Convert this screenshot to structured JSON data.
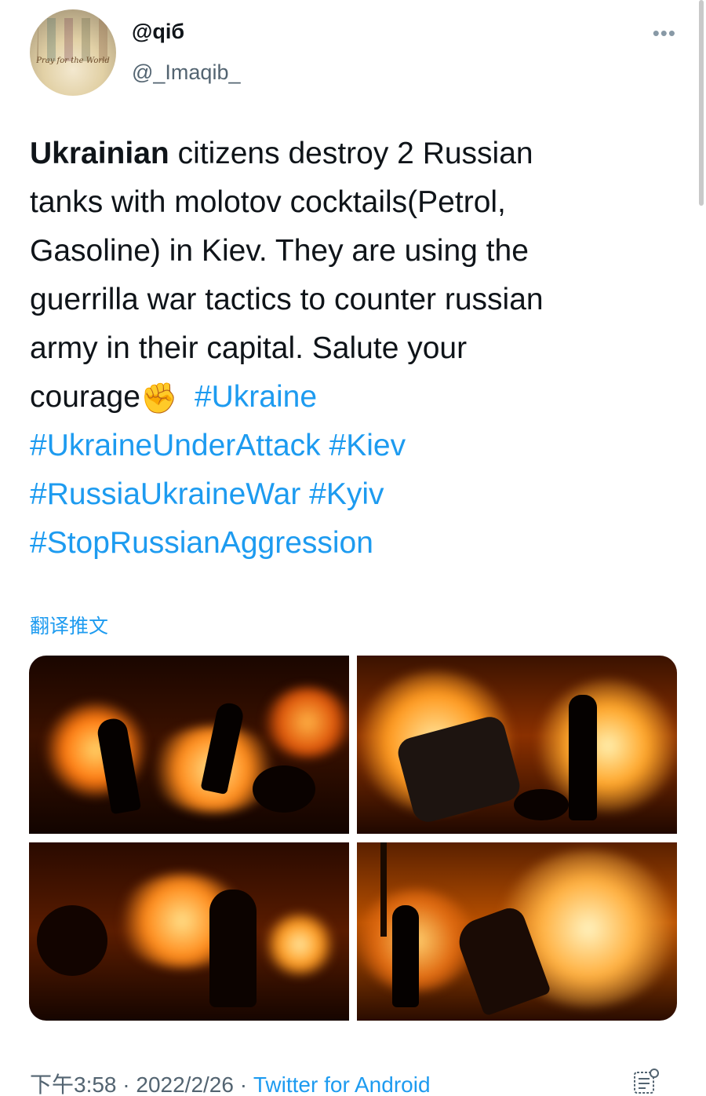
{
  "tweet": {
    "author": {
      "display_name": "@qiб",
      "handle": "@_Imaqib_",
      "avatar_text": "Pray for the World"
    },
    "more_icon": "more-horizontal-icon",
    "text_parts": {
      "bold_lead": "Ukrainian",
      "line_1_rest": " citizens destroy 2 Russian",
      "line_2": "tanks with molotov cocktails(Petrol,",
      "line_3": "Gasoline) in Kiev. They are using the",
      "line_4": "guerrilla war tactics to counter russian",
      "line_5": "army in their capital. Salute your",
      "line_6": "courage"
    },
    "emoji": "✊",
    "hashtags": [
      "#Ukraine",
      "#UkraineUnderAttack",
      "#Kiev",
      "#RussiaUkraineWar",
      "#Kyiv",
      "#StopRussianAggression"
    ],
    "translate_label": "翻译推文",
    "footer": {
      "time": "下午3:58",
      "separator": " · ",
      "date": "2022/2/26",
      "source": "Twitter for Android"
    },
    "analytics_icon": "analytics-icon"
  },
  "colors": {
    "link": "#1d9bf0",
    "text": "#0f1419",
    "muted": "#536471",
    "fire": "#ff8a1a"
  }
}
